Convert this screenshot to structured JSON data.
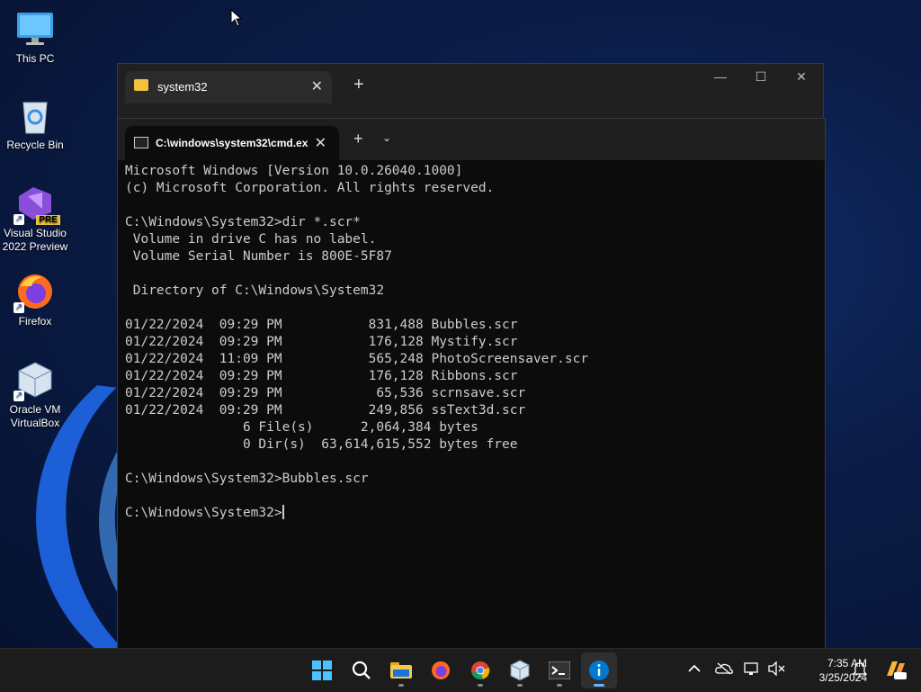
{
  "desktop": {
    "icons": [
      {
        "label": "This PC"
      },
      {
        "label": "Recycle Bin"
      },
      {
        "label": "Visual Studio 2022 Preview",
        "badge": "PRE"
      },
      {
        "label": "Firefox"
      },
      {
        "label": "Oracle VM VirtualBox"
      }
    ]
  },
  "explorer": {
    "tab_title": "system32",
    "new_tab": "+",
    "close": "✕",
    "minimize": "—",
    "maximize": "☐"
  },
  "terminal": {
    "tab_title": "C:\\windows\\system32\\cmd.ex",
    "close": "✕",
    "new_tab": "+",
    "dropdown": "⌄",
    "lines": [
      "Microsoft Windows [Version 10.0.26040.1000]",
      "(c) Microsoft Corporation. All rights reserved.",
      "",
      "C:\\Windows\\System32>dir *.scr*",
      " Volume in drive C has no label.",
      " Volume Serial Number is 800E-5F87",
      "",
      " Directory of C:\\Windows\\System32",
      "",
      "01/22/2024  09:29 PM           831,488 Bubbles.scr",
      "01/22/2024  09:29 PM           176,128 Mystify.scr",
      "01/22/2024  11:09 PM           565,248 PhotoScreensaver.scr",
      "01/22/2024  09:29 PM           176,128 Ribbons.scr",
      "01/22/2024  09:29 PM            65,536 scrnsave.scr",
      "01/22/2024  09:29 PM           249,856 ssText3d.scr",
      "               6 File(s)      2,064,384 bytes",
      "               0 Dir(s)  63,614,615,552 bytes free",
      "",
      "C:\\Windows\\System32>Bubbles.scr",
      ""
    ],
    "prompt": "C:\\Windows\\System32>"
  },
  "taskbar": {
    "apps": [
      "start",
      "search",
      "file-explorer",
      "firefox",
      "chrome",
      "virtualbox",
      "terminal",
      "info"
    ],
    "active_app": "info",
    "clock_time": "7:35 AM",
    "clock_date": "3/25/2024"
  },
  "colors": {
    "console_text": "#cccccc",
    "accent": "#0078d4"
  }
}
